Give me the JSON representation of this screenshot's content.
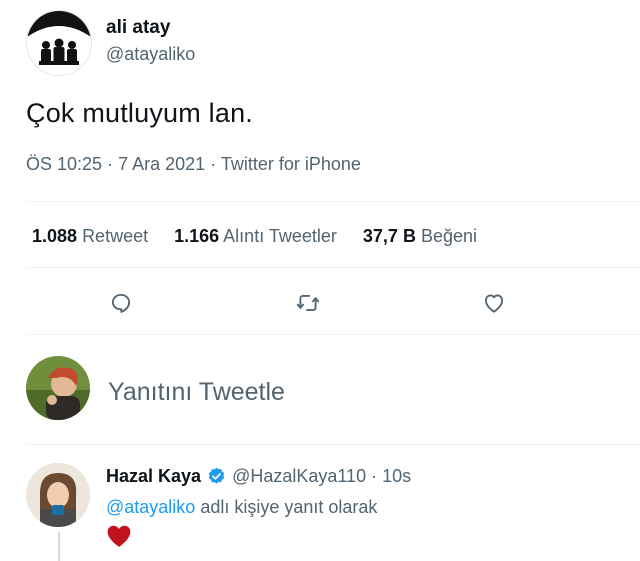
{
  "tweet": {
    "author": {
      "name": "ali atay",
      "handle": "@atayaliko"
    },
    "text": "Çok mutluyum lan.",
    "meta": {
      "time": "ÖS 10:25",
      "date": "7 Ara 2021",
      "source": "Twitter for iPhone",
      "separator": "·"
    },
    "stats": {
      "retweets": {
        "count": "1.088",
        "label": "Retweet"
      },
      "quotes": {
        "count": "1.166",
        "label": "Alıntı Tweetler"
      },
      "likes": {
        "count": "37,7 B",
        "label": "Beğeni"
      }
    },
    "actions": {
      "reply_icon": "comment-icon",
      "retweet_icon": "retweet-icon",
      "like_icon": "heart-icon"
    }
  },
  "reply_composer": {
    "placeholder": "Yanıtını Tweetle"
  },
  "reply": {
    "name": "Hazal Kaya",
    "handle_time": "@HazalKaya110 · 10s",
    "mention": "@atayaliko",
    "reply_label": "adlı kişiye yanıt olarak",
    "content_icon": "red-heart-emoji",
    "verified_color": "#1d9bf0"
  },
  "colors": {
    "text": "#0f1419",
    "muted": "#536471",
    "accent": "#1d9bf0",
    "heart": "#c1121f"
  }
}
